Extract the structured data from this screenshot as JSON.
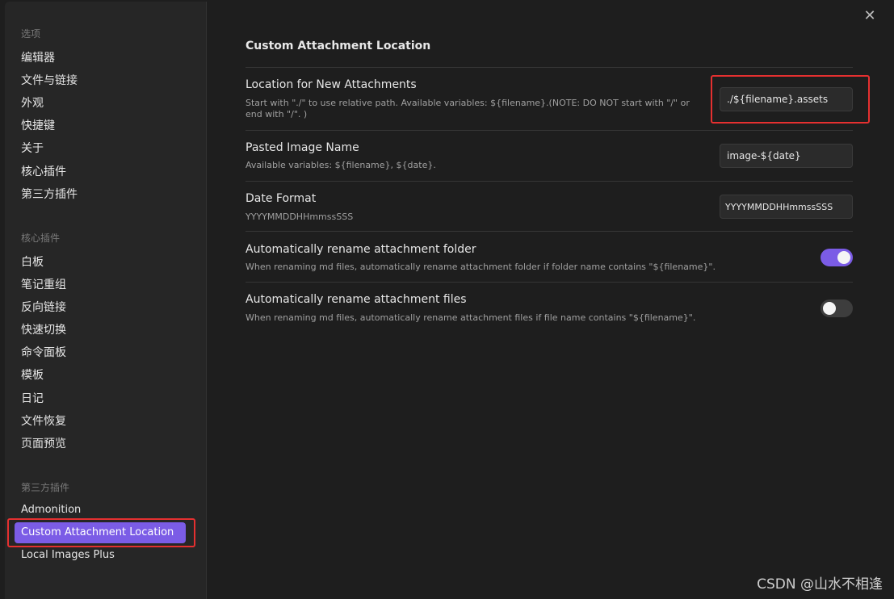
{
  "sidebar": {
    "section_options": "选项",
    "options": [
      "编辑器",
      "文件与链接",
      "外观",
      "快捷键",
      "关于",
      "核心插件",
      "第三方插件"
    ],
    "section_core": "核心插件",
    "core": [
      "白板",
      "笔记重组",
      "反向链接",
      "快速切换",
      "命令面板",
      "模板",
      "日记",
      "文件恢复",
      "页面预览"
    ],
    "section_third": "第三方插件",
    "third": [
      "Admonition",
      "Custom Attachment Location",
      "Local Images Plus"
    ]
  },
  "content": {
    "close_glyph": "✕",
    "title": "Custom Attachment Location",
    "settings": [
      {
        "name": "Location for New Attachments",
        "desc": "Start with \"./\" to use relative path. Available variables: ${filename}.(NOTE: DO NOT start with \"/\" or end with \"/\". )",
        "value": "./${filename}.assets"
      },
      {
        "name": "Pasted Image Name",
        "desc": "Available variables: ${filename}, ${date}.",
        "value": "image-${date}"
      },
      {
        "name": "Date Format",
        "desc": "YYYYMMDDHHmmssSSS",
        "value": "YYYYMMDDHHmmssSSS"
      },
      {
        "name": "Automatically rename attachment folder",
        "desc": "When renaming md files, automatically rename attachment folder if folder name contains \"${filename}\".",
        "enabled": true
      },
      {
        "name": "Automatically rename attachment files",
        "desc": "When renaming md files, automatically rename attachment files if file name contains \"${filename}\".",
        "enabled": false
      }
    ]
  },
  "watermark": "CSDN @山水不相逢",
  "colors": {
    "accent": "#7b5ce6",
    "annotation": "#e53030"
  }
}
